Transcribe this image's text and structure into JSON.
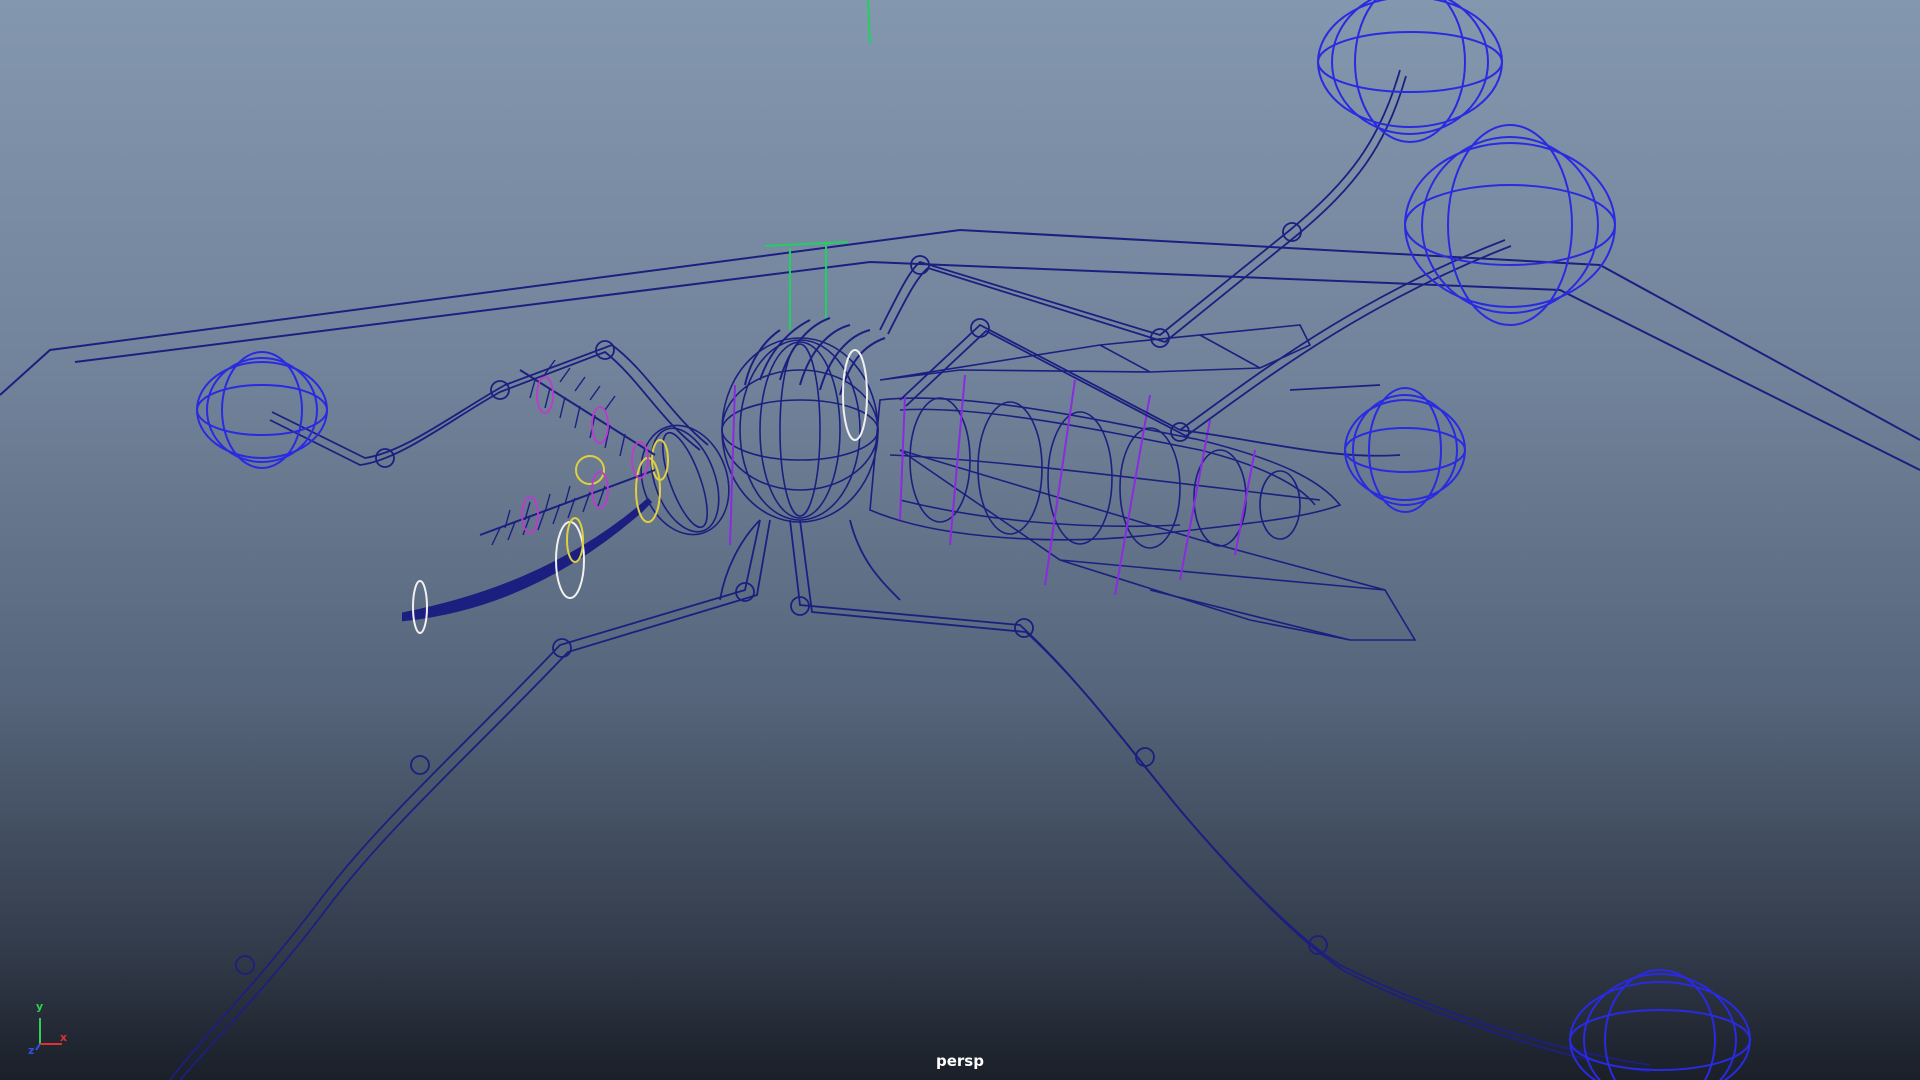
{
  "viewport": {
    "camera_name": "persp",
    "background_top": "#8397ae",
    "background_bottom": "#1a1f28",
    "wireframe_color": "#1c1f80",
    "controller_color": "#2a2ae0",
    "selection_colors": {
      "magenta": "#c038d0",
      "yellow": "#e0d040",
      "white": "#f0f0f0",
      "green": "#20d060"
    }
  },
  "axis_gizmo": {
    "x_label": "x",
    "y_label": "y",
    "z_label": "z",
    "x_color": "#e03030",
    "y_color": "#30d050",
    "z_color": "#3050e0"
  },
  "icons": [
    "axis-gizmo-icon"
  ]
}
